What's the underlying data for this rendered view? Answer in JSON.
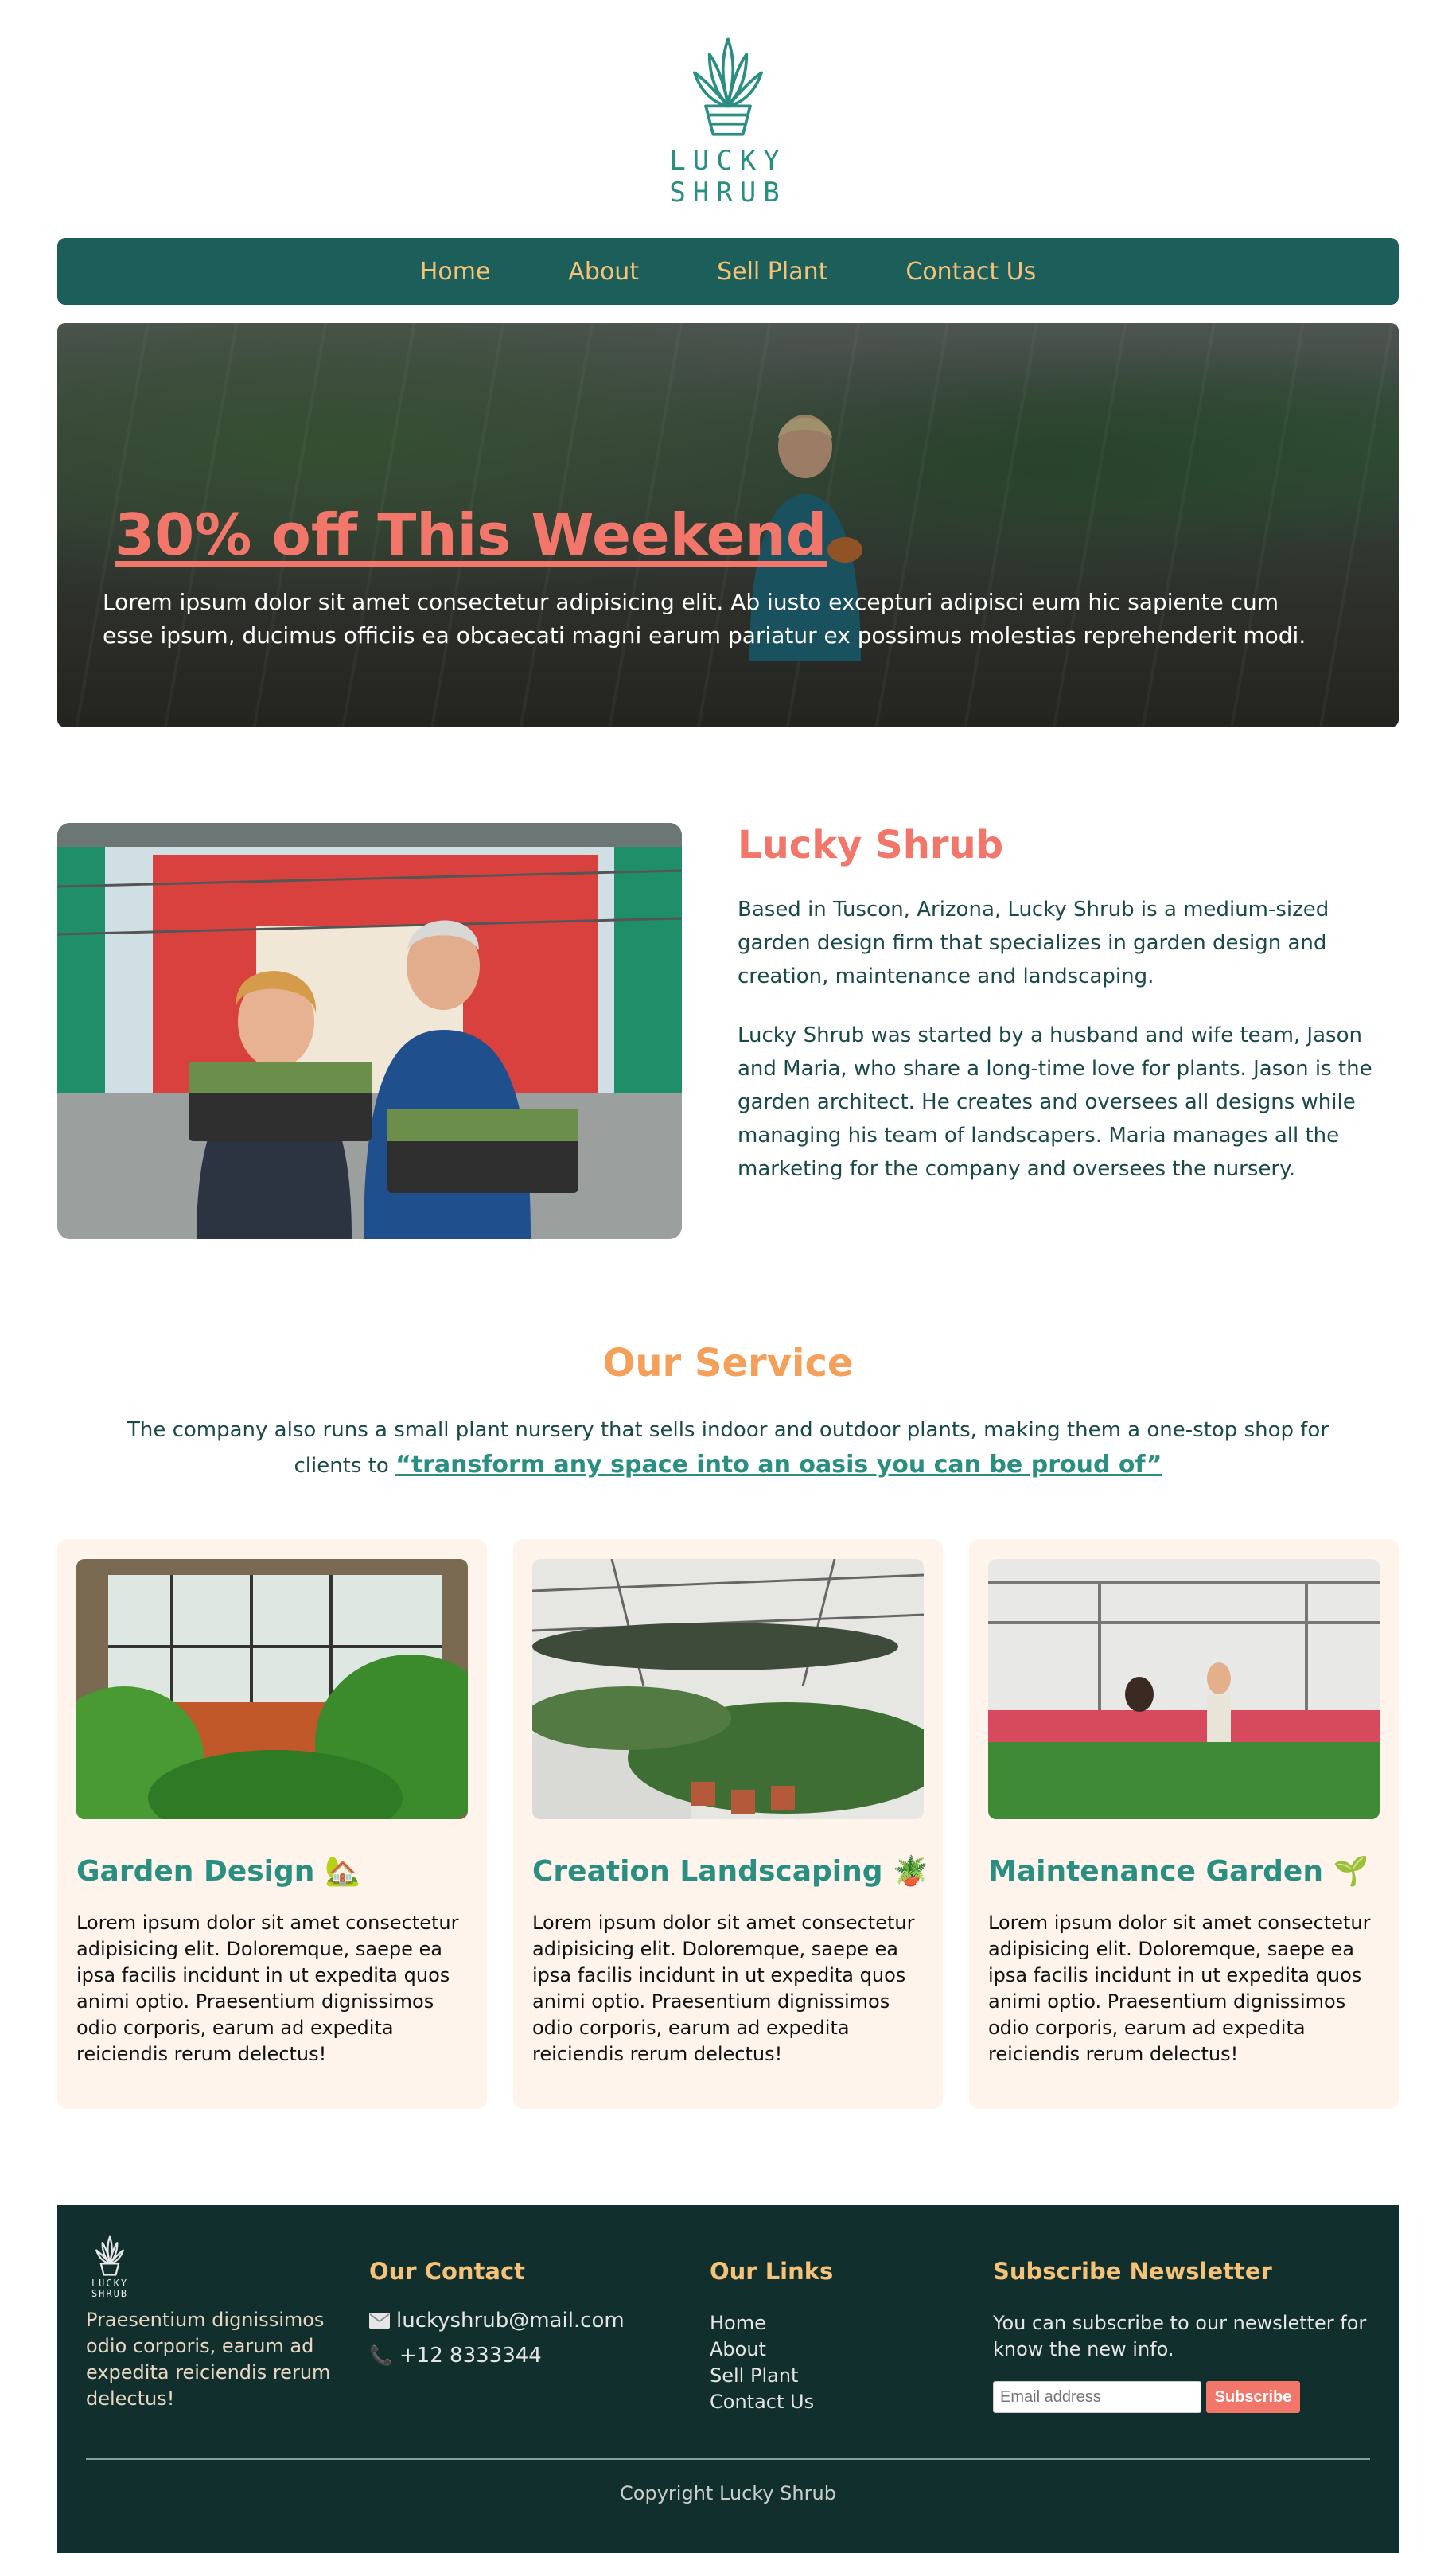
{
  "brand": {
    "name_line1": "LUCKY",
    "name_line2": "SHRUB",
    "logo_icon": "plant-pot-icon"
  },
  "nav": {
    "items": [
      "Home",
      "About",
      "Sell Plant",
      "Contact Us"
    ]
  },
  "hero": {
    "headline": "30% off This Weekend",
    "text": "Lorem ipsum dolor sit amet consectetur adipisicing elit. Ab iusto excepturi adipisci eum hic sapiente cum esse ipsum, ducimus officiis ea obcaecati magni earum pariatur ex possimus molestias reprehenderit modi."
  },
  "about": {
    "title": "Lucky Shrub",
    "p1": "Based in Tuscon, Arizona, Lucky Shrub is a medium-sized garden design firm that specializes in garden design and creation, maintenance and landscaping.",
    "p2": "Lucky Shrub was started by a husband and wife team, Jason and Maria, who share a long-time love for plants. Jason is the garden architect. He creates and oversees all designs while managing his team of landscapers. Maria manages all the marketing for the company and oversees the nursery."
  },
  "service": {
    "title": "Our Service",
    "intro": "The company also runs a small plant nursery that sells indoor and outdoor plants, making them a one-stop shop for clients to",
    "quote": "“transform any space into an oasis you can be proud of”",
    "cards": [
      {
        "title": "Garden Design",
        "emoji": "🏡",
        "text": "Lorem ipsum dolor sit amet consectetur adipisicing elit. Doloremque, saepe ea ipsa facilis incidunt in ut expedita quos animi optio. Praesentium dignissimos odio corporis, earum ad expedita reiciendis rerum delectus!"
      },
      {
        "title": "Creation Landscaping",
        "emoji": "🪴",
        "text": "Lorem ipsum dolor sit amet consectetur adipisicing elit. Doloremque, saepe ea ipsa facilis incidunt in ut expedita quos animi optio. Praesentium dignissimos odio corporis, earum ad expedita reiciendis rerum delectus!"
      },
      {
        "title": "Maintenance Garden",
        "emoji": "🌱",
        "text": "Lorem ipsum dolor sit amet consectetur adipisicing elit. Doloremque, saepe ea ipsa facilis incidunt in ut expedita quos animi optio. Praesentium dignissimos odio corporis, earum ad expedita reiciendis rerum delectus!"
      }
    ]
  },
  "footer": {
    "logo_line1": "LUCKY",
    "logo_line2": "SHRUB",
    "about": "Praesentium dignissimos odio corporis, earum ad expedita reiciendis rerum delectus!",
    "contact_title": "Our Contact",
    "email": "luckyshrub@mail.com",
    "phone": "+12 8333344",
    "links_title": "Our Links",
    "links": [
      "Home",
      "About",
      "Sell Plant",
      "Contact Us"
    ],
    "newsletter_title": "Subscribe Newsletter",
    "newsletter_text": "You can subscribe to our newsletter for know the new info.",
    "email_placeholder": "Email address",
    "subscribe_label": "Subscribe",
    "copyright": "Copyright Lucky Shrub"
  },
  "colors": {
    "teal_dark": "#1c5f5a",
    "teal": "#2a8f80",
    "coral": "#f2776a",
    "orange": "#f4a05a",
    "gold": "#f6c277",
    "footer_bg": "#102f2d",
    "card_bg": "#fef4ec"
  }
}
